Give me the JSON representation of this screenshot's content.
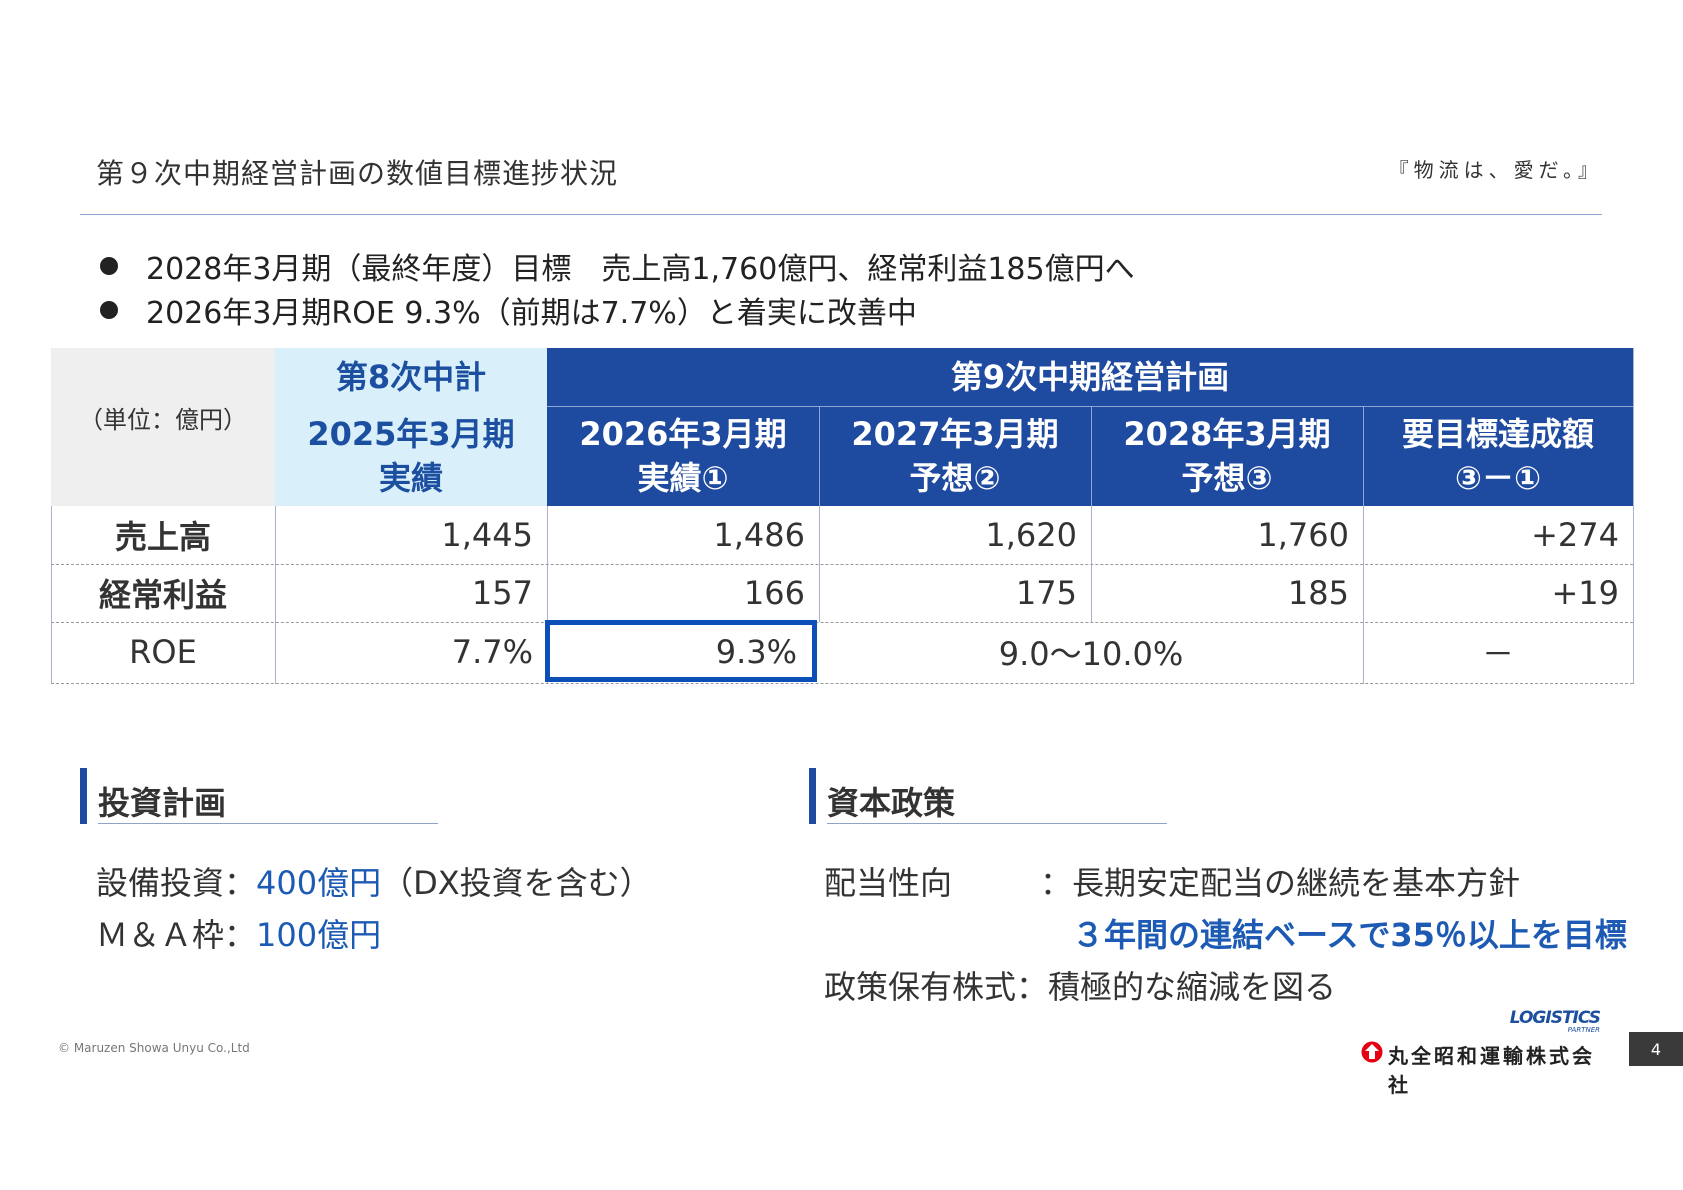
{
  "header": {
    "title": "第９次中期経営計画の数値目標進捗状況",
    "slogan": "『物流は、愛だ。』"
  },
  "bullets": [
    "2028年3月期（最終年度）目標　売上高1,760億円、経常利益185億円へ",
    "2026年3月期ROE 9.3%（前期は7.7%）と着実に改善中"
  ],
  "table": {
    "unit_label": "（単位：億円）",
    "group_8th": "第8次中計",
    "group_9th": "第9次中期経営計画",
    "columns": [
      {
        "line1": "2025年3月期",
        "line2": "実績"
      },
      {
        "line1": "2026年3月期",
        "line2": "実績①"
      },
      {
        "line1": "2027年3月期",
        "line2": "予想②"
      },
      {
        "line1": "2028年3月期",
        "line2": "予想③"
      },
      {
        "line1": "要目標達成額",
        "line2": "③－①"
      }
    ],
    "rows": [
      {
        "label": "売上高",
        "values": [
          "1,445",
          "1,486",
          "1,620",
          "1,760",
          "+274"
        ]
      },
      {
        "label": "経常利益",
        "values": [
          "157",
          "166",
          "175",
          "185",
          "+19"
        ]
      },
      {
        "label": "ROE",
        "values": [
          "7.7%",
          "9.3%",
          "9.0～10.0%",
          "－"
        ]
      }
    ]
  },
  "investment": {
    "title": "投資計画",
    "capex_label": "設備投資：",
    "capex_value": "400億円",
    "capex_note": "（DX投資を含む）",
    "ma_label": "Ｍ＆Ａ枠：",
    "ma_value": "100億円"
  },
  "capital_policy": {
    "title": "資本政策",
    "payout_label": "配当性向",
    "payout_text": "：長期安定配当の継続を基本方針",
    "payout_target": "３年間の連結ベースで35％以上を目標",
    "cross_label": "政策保有株式：積極的な縮減を図る"
  },
  "footer": {
    "copyright": "© Maruzen Showa Unyu Co.,Ltd",
    "company_name": "丸全昭和運輸株式会社",
    "logo_text": "LOGISTICS",
    "logo_sub": "PARTNER",
    "page_number": "4"
  },
  "colors": {
    "navy": "#1e4aa0",
    "light_blue": "#d9f0fb",
    "accent_blue": "#1c5ab4",
    "logo_red": "#e60012"
  }
}
